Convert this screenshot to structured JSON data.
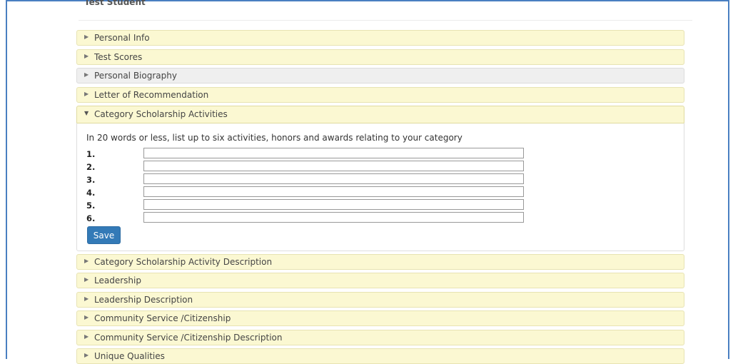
{
  "page_header": "Test Student",
  "panels_top": [
    {
      "label": "Personal Info",
      "style": "yellow"
    },
    {
      "label": "Test Scores",
      "style": "yellow"
    },
    {
      "label": "Personal Biography",
      "style": "gray"
    },
    {
      "label": "Letter of Recommendation",
      "style": "yellow"
    }
  ],
  "open_panel": {
    "label": "Category Scholarship Activities",
    "instruction": "In 20 words or less, list up to six activities, honors and awards relating to your category",
    "rows": [
      {
        "num": "1.",
        "value": ""
      },
      {
        "num": "2.",
        "value": ""
      },
      {
        "num": "3.",
        "value": ""
      },
      {
        "num": "4.",
        "value": ""
      },
      {
        "num": "5.",
        "value": ""
      },
      {
        "num": "6.",
        "value": ""
      }
    ],
    "save_label": "Save"
  },
  "panels_bottom": [
    {
      "label": "Category Scholarship Activity Description"
    },
    {
      "label": "Leadership"
    },
    {
      "label": "Leadership Description"
    },
    {
      "label": "Community Service /Citizenship"
    },
    {
      "label": "Community Service /Citizenship Description"
    },
    {
      "label": "Unique Qualities"
    }
  ],
  "colors": {
    "panel_yellow": "#fbf8d2",
    "panel_gray": "#efefef",
    "save_button": "#337ab7",
    "frame_border": "#4a7fc1"
  },
  "icons": {
    "collapsed": "caret-right-icon",
    "expanded": "caret-down-icon"
  }
}
